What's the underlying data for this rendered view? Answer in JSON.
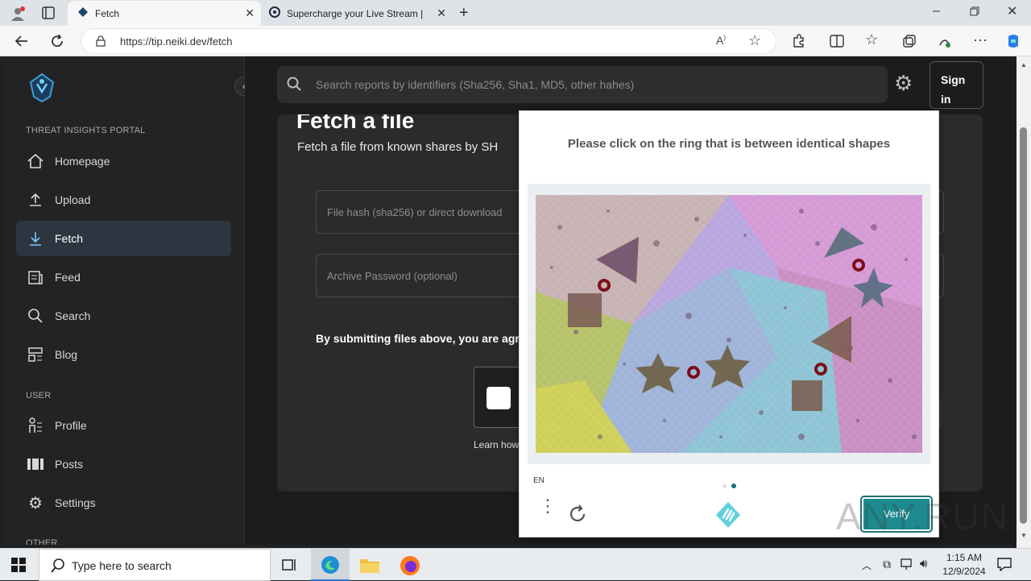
{
  "browser": {
    "tabs": [
      {
        "label": "Fetch",
        "icon": "neiki-icon"
      },
      {
        "label": "Supercharge your Live Stream | S",
        "icon": "stream-icon"
      }
    ],
    "url": "https://tip.neiki.dev/fetch"
  },
  "sidebar": {
    "portal_label": "THREAT INSIGHTS PORTAL",
    "user_label": "USER",
    "other_label": "OTHER",
    "items": [
      {
        "label": "Homepage",
        "icon": "home-icon"
      },
      {
        "label": "Upload",
        "icon": "upload-icon"
      },
      {
        "label": "Fetch",
        "icon": "download-icon",
        "active": true
      },
      {
        "label": "Feed",
        "icon": "feed-icon"
      },
      {
        "label": "Search",
        "icon": "search-icon"
      },
      {
        "label": "Blog",
        "icon": "blog-icon"
      }
    ],
    "user_items": [
      {
        "label": "Profile",
        "icon": "profile-icon"
      },
      {
        "label": "Posts",
        "icon": "posts-icon"
      },
      {
        "label": "Settings",
        "icon": "gear-icon"
      }
    ]
  },
  "topbar": {
    "search_placeholder": "Search reports by identifiers (Sha256, Sha1, MD5, other hahes)",
    "signin_label": "Sign in"
  },
  "main": {
    "title": "Fetch a file",
    "subtitle": "Fetch a file from known shares by SH",
    "hash_placeholder": "File hash (sha256) or direct download",
    "password_placeholder": "Archive Password (optional)",
    "terms_text": "By submitting files above, you are agre",
    "learn_text": "Learn how"
  },
  "captcha": {
    "prompt": "Please click on the ring that is between identical shapes",
    "language": "EN",
    "verify_label": "Verify",
    "page_dots": [
      false,
      true
    ]
  },
  "taskbar": {
    "search_placeholder": "Type here to search",
    "time": "1:15 AM",
    "date": "12/9/2024"
  },
  "watermark": "ANY.RUN",
  "colors": {
    "accent_teal": "#1c8a8f",
    "active_nav": "#2c3540"
  }
}
